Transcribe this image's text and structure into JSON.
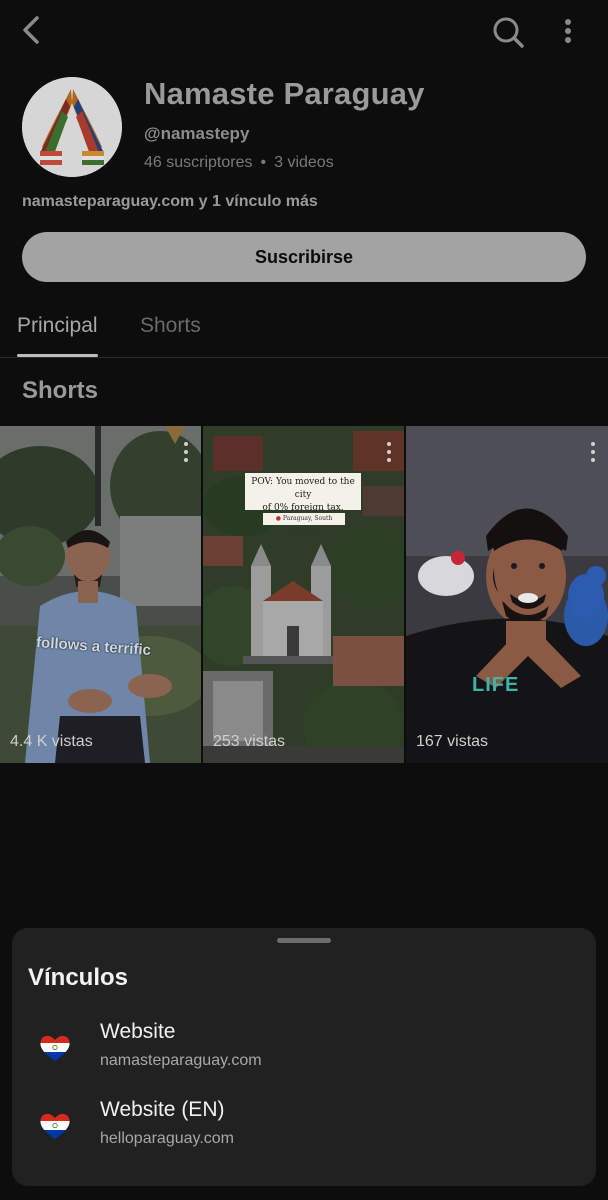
{
  "channel": {
    "name": "Namaste Paraguay",
    "handle": "@namastepy",
    "subscribers": "46 suscriptores",
    "videos": "3 videos",
    "links_text": "namasteparaguay.com y 1 vínculo más",
    "subscribe_label": "Suscribirse"
  },
  "tabs": [
    {
      "label": "Principal",
      "active": true
    },
    {
      "label": "Shorts",
      "active": false
    }
  ],
  "section_title": "Shorts",
  "shorts": [
    {
      "views": "4.4 K vistas",
      "overlay": "follows a terrific"
    },
    {
      "views": "253 vistas",
      "caption_line1": "POV: You moved to the city",
      "caption_line2": "of 0% foreign tax.",
      "location": "Paraguay, South America"
    },
    {
      "views": "167 vistas",
      "overlay": "LIFE"
    }
  ],
  "sheet": {
    "title": "Vínculos",
    "links": [
      {
        "label": "Website",
        "url": "namasteparaguay.com",
        "icon": "paraguay-heart-flag-icon"
      },
      {
        "label": "Website (EN)",
        "url": "helloparaguay.com",
        "icon": "paraguay-heart-flag-icon"
      }
    ]
  },
  "colors": {
    "background": "#0d0d0d",
    "sheet": "#212121",
    "subscribe_button": "#a3a3a3",
    "flag_red": "#d52b1e",
    "flag_blue": "#0038a8"
  }
}
